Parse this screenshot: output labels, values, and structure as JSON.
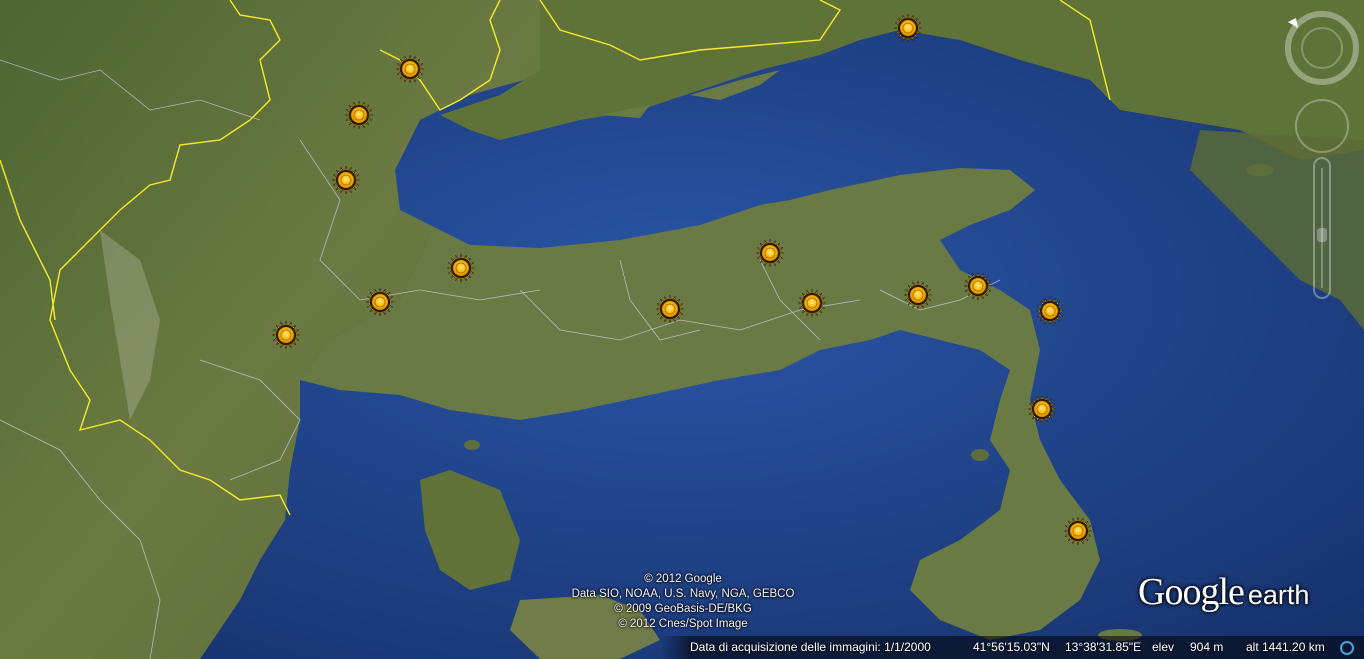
{
  "map": {
    "colors": {
      "sea": "#22468f",
      "land": "#5c6e3a",
      "border_national": "#f4ea2a",
      "border_regional": "#c8c8e6"
    },
    "markers": [
      {
        "name": "sun-marker-1",
        "icon": "sun-icon"
      },
      {
        "name": "sun-marker-2",
        "icon": "sun-icon"
      },
      {
        "name": "sun-marker-3",
        "icon": "sun-icon"
      },
      {
        "name": "sun-marker-4",
        "icon": "sun-icon"
      },
      {
        "name": "sun-marker-5",
        "icon": "sun-icon"
      },
      {
        "name": "sun-marker-6",
        "icon": "sun-icon"
      },
      {
        "name": "sun-marker-7",
        "icon": "sun-icon"
      },
      {
        "name": "sun-marker-8",
        "icon": "sun-icon"
      },
      {
        "name": "sun-marker-9",
        "icon": "sun-icon"
      },
      {
        "name": "sun-marker-10",
        "icon": "sun-icon"
      },
      {
        "name": "sun-marker-11",
        "icon": "sun-icon"
      },
      {
        "name": "sun-marker-12",
        "icon": "sun-icon"
      },
      {
        "name": "sun-marker-13",
        "icon": "sun-icon"
      },
      {
        "name": "sun-marker-14",
        "icon": "sun-icon"
      },
      {
        "name": "sun-marker-15",
        "icon": "sun-icon"
      },
      {
        "name": "sun-marker-16",
        "icon": "sun-icon"
      }
    ]
  },
  "attribution": {
    "line1": "© 2012 Google",
    "line2": "Data SIO, NOAA, U.S. Navy, NGA, GEBCO",
    "line3": "© 2009 GeoBasis-DE/BKG",
    "line4": "© 2012 Cnes/Spot Image"
  },
  "logo": {
    "google": "Google",
    "earth": "earth"
  },
  "status": {
    "imagery_date": "Data di acquisizione delle immagini: 1/1/2000",
    "lat": "41°56'15.03\"N",
    "lon": "13°38'31.85\"E",
    "elev_label": "elev",
    "elev_value": "904 m",
    "alt": "alt 1441.20 km"
  },
  "navigation": {
    "icons": [
      "north-up-icon",
      "look-joystick-icon",
      "move-joystick-icon",
      "zoom-slider-icon"
    ]
  }
}
